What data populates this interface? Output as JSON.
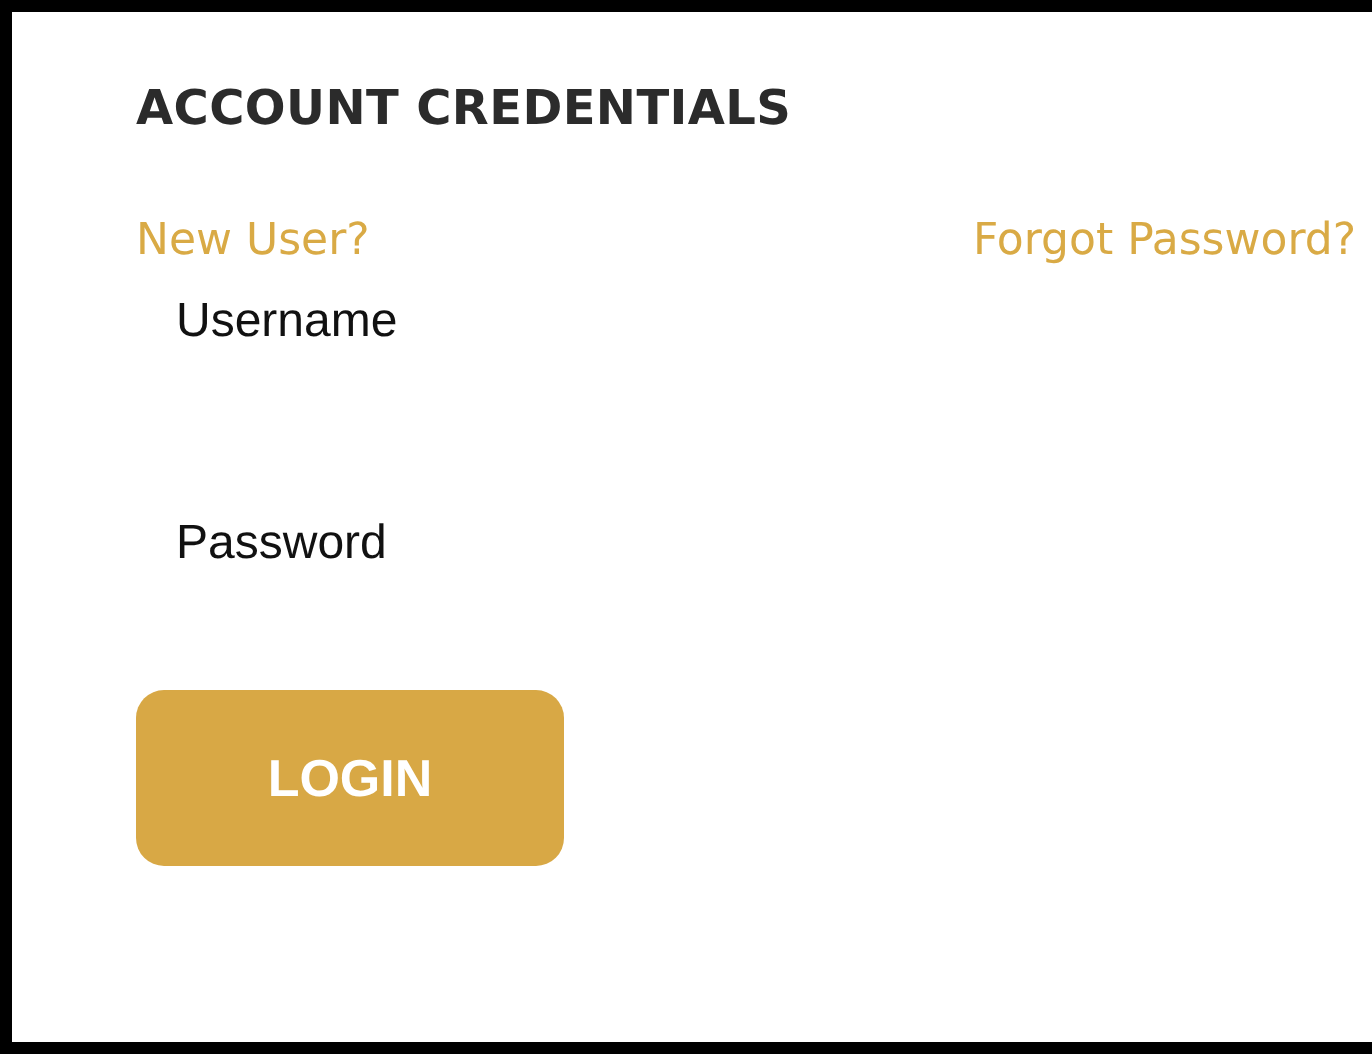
{
  "title": "ACCOUNT CREDENTIALS",
  "links": [
    {
      "label": "New User?"
    },
    {
      "label": "Forgot Password?"
    }
  ],
  "fields": [
    {
      "label": "Username"
    },
    {
      "label": "Password"
    }
  ],
  "button": {
    "label": "LOGIN"
  }
}
